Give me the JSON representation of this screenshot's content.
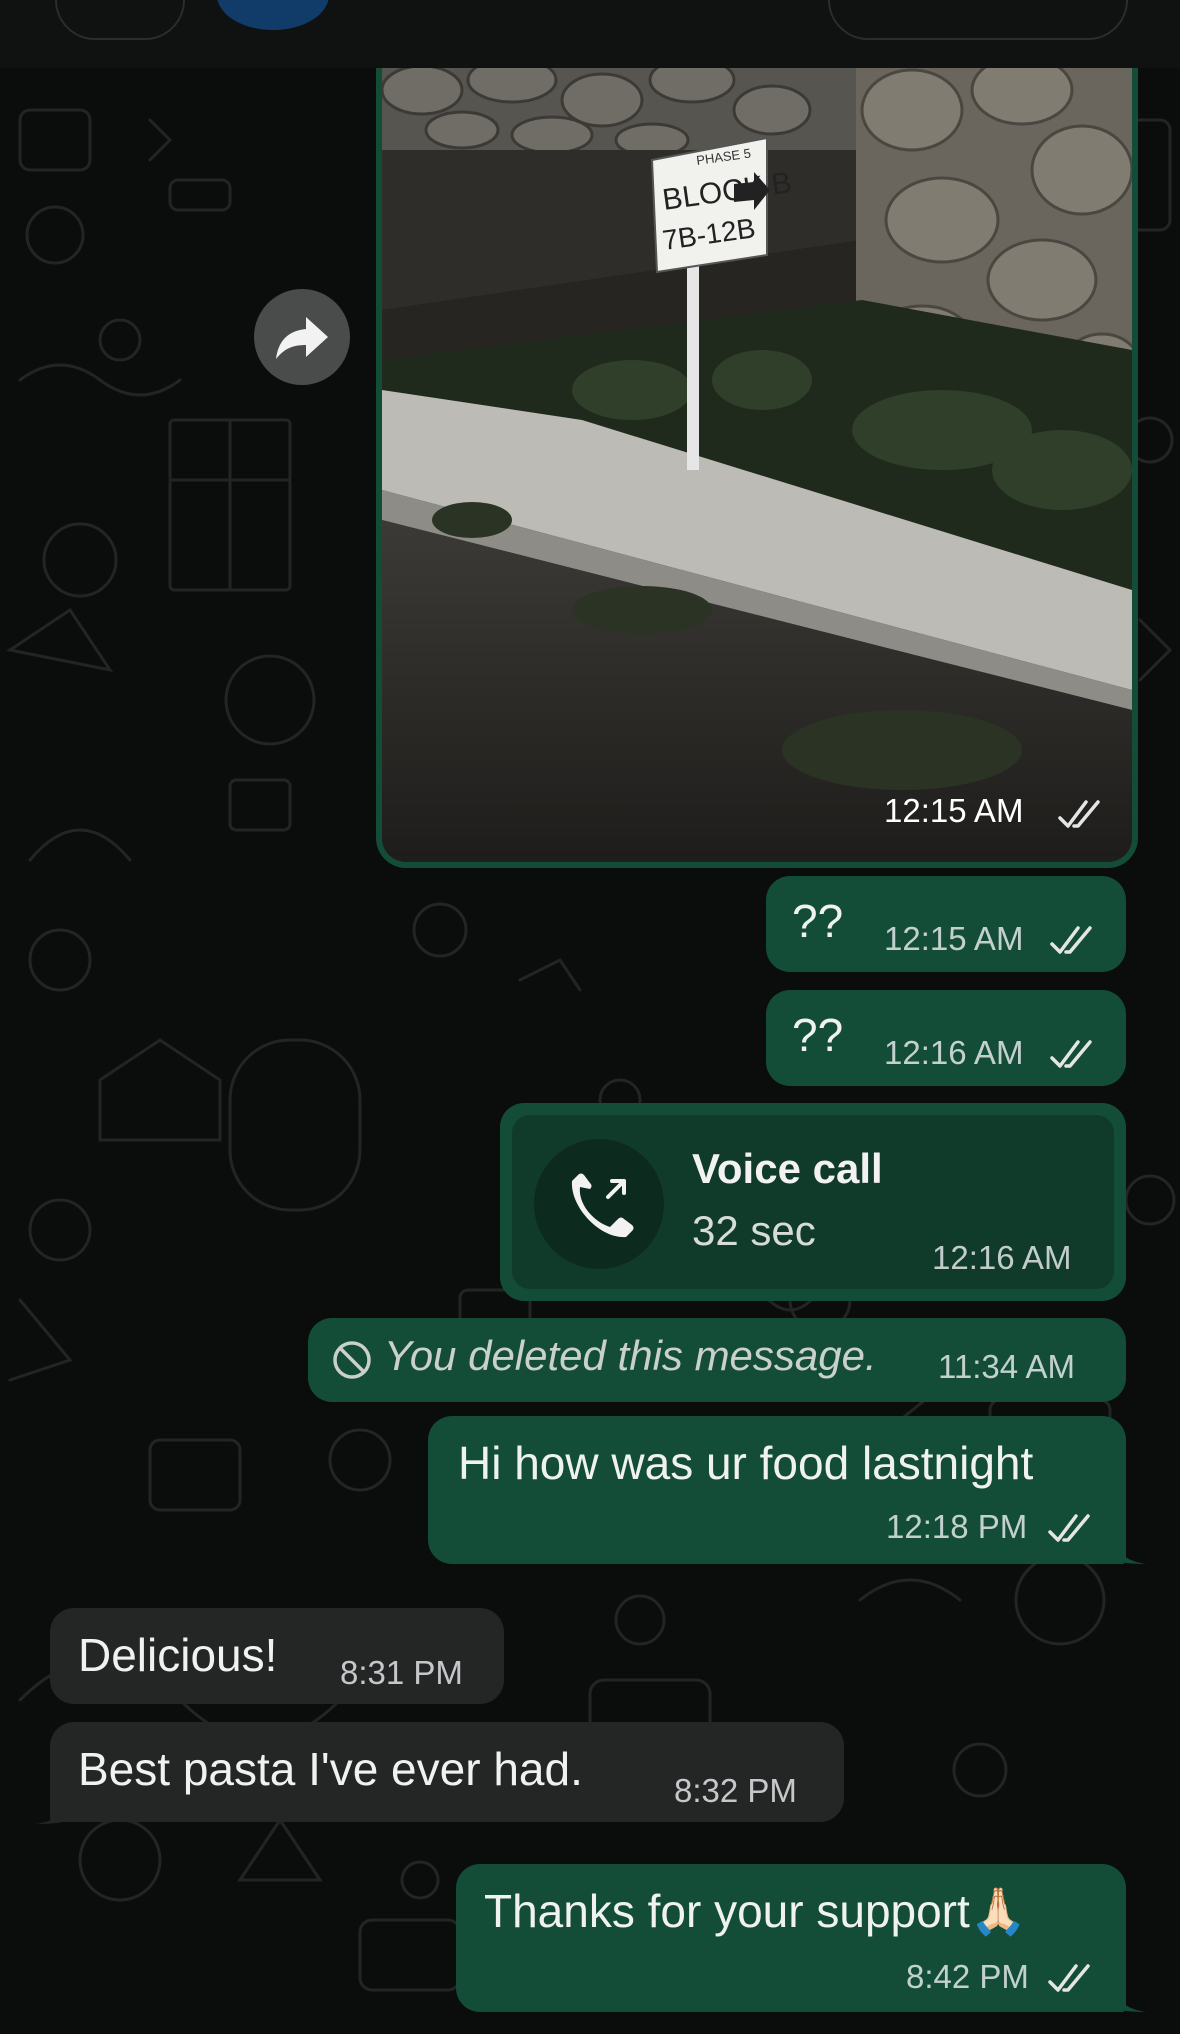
{
  "colors": {
    "outgoing_bubble": "#134d37",
    "incoming_bubble": "#242626",
    "background": "#0b0c0c",
    "text": "#f0f2f2"
  },
  "header": {
    "back_icon": "chevron-left-icon",
    "actions": [
      "video-call-icon",
      "phone-icon"
    ]
  },
  "forward_icon": "forward-arrow-icon",
  "messages": [
    {
      "type": "image",
      "direction": "out",
      "time": "12:15 AM",
      "status": "read",
      "image_caption": "Night photo of a stone wall and a sign reading PHASE 5 BLOCK B 7B-12B"
    },
    {
      "type": "text",
      "direction": "out",
      "text": "??",
      "time": "12:15 AM",
      "status": "read"
    },
    {
      "type": "text",
      "direction": "out",
      "text": "??",
      "time": "12:16 AM",
      "status": "read"
    },
    {
      "type": "call",
      "direction": "out",
      "title": "Voice call",
      "duration": "32 sec",
      "time": "12:16 AM",
      "icon": "outgoing-call-icon"
    },
    {
      "type": "deleted",
      "direction": "out",
      "text": "You deleted this message.",
      "time": "11:34 AM",
      "icon": "blocked-icon"
    },
    {
      "type": "text",
      "direction": "out",
      "text": "Hi how was ur food lastnight",
      "time": "12:18 PM",
      "status": "read"
    },
    {
      "type": "text",
      "direction": "in",
      "text": "Delicious!",
      "time": "8:31 PM"
    },
    {
      "type": "text",
      "direction": "in",
      "text": "Best pasta I've ever had.",
      "time": "8:32 PM"
    },
    {
      "type": "text",
      "direction": "out",
      "text": "Thanks for your support🙏🏻",
      "time": "8:42 PM",
      "status": "read"
    }
  ],
  "sign": {
    "line1": "PHASE 5",
    "line2": "BLOCK B",
    "line3": "7B-12B"
  }
}
